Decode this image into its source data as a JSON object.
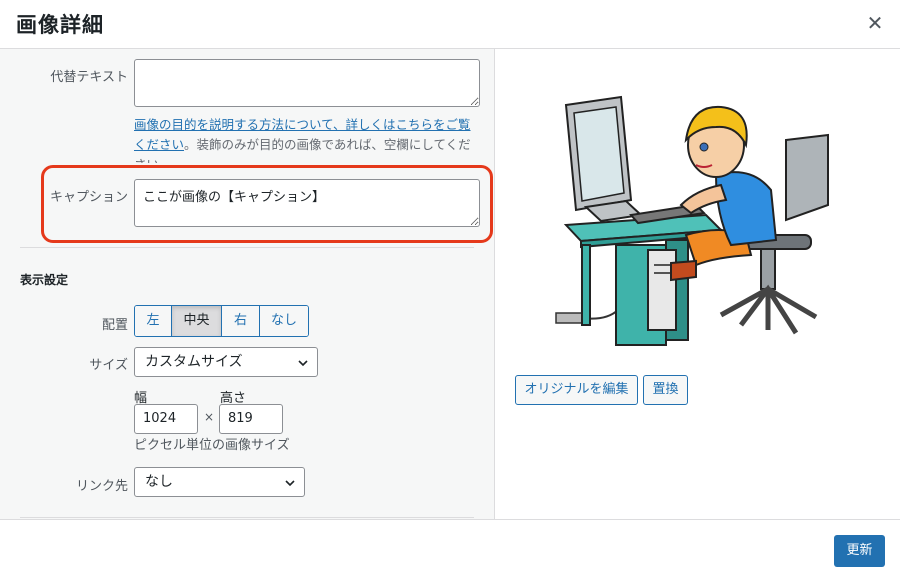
{
  "header": {
    "title": "画像詳細",
    "close_icon": "close-icon"
  },
  "alt_text": {
    "label": "代替テキスト",
    "value": ""
  },
  "description": {
    "link_text": "画像の目的を説明する方法について、詳しくはこちらをご覧ください",
    "rest_text": "。装飾のみが目的の画像であれば、空欄にしてください。"
  },
  "caption": {
    "label": "キャプション",
    "value": "ここが画像の【キャプション】",
    "highlight_color": "#e5391b"
  },
  "display_settings": {
    "title": "表示設定",
    "align": {
      "label": "配置",
      "options": [
        "左",
        "中央",
        "右",
        "なし"
      ],
      "selected": "中央"
    },
    "size": {
      "label": "サイズ",
      "value": "カスタムサイズ"
    },
    "width": {
      "label": "幅",
      "value": "1024"
    },
    "height": {
      "label": "高さ",
      "value": "819"
    },
    "times": "×",
    "hint": "ピクセル単位の画像サイズ",
    "link": {
      "label": "リンク先",
      "value": "なし"
    }
  },
  "preview": {
    "edit_button": "オリジナルを編集",
    "replace_button": "置換"
  },
  "footer": {
    "update_button": "更新"
  },
  "colors": {
    "accent": "#2271b1",
    "highlight": "#e5391b"
  }
}
